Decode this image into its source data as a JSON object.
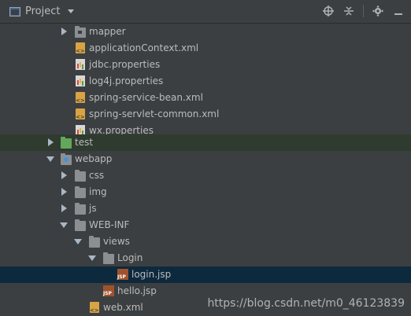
{
  "toolbar": {
    "title": "Project",
    "icons": [
      "locate-icon",
      "collapse-icon",
      "gear-icon",
      "hide-icon"
    ]
  },
  "tree": {
    "items": [
      {
        "label": "mapper",
        "icon": "folder-icon",
        "expanded": false
      },
      {
        "label": "applicationContext.xml",
        "icon": "xml-file-icon"
      },
      {
        "label": "jdbc.properties",
        "icon": "properties-file-icon"
      },
      {
        "label": "log4j.properties",
        "icon": "properties-file-icon"
      },
      {
        "label": "spring-service-bean.xml",
        "icon": "xml-file-icon"
      },
      {
        "label": "spring-servlet-common.xml",
        "icon": "xml-file-icon"
      },
      {
        "label": "wx.properties",
        "icon": "properties-file-icon"
      },
      {
        "label": "test",
        "icon": "folder-green-icon",
        "expanded": false
      },
      {
        "label": "webapp",
        "icon": "web-folder-icon",
        "expanded": true
      },
      {
        "label": "css",
        "icon": "folder-icon",
        "expanded": false
      },
      {
        "label": "img",
        "icon": "folder-icon",
        "expanded": false
      },
      {
        "label": "js",
        "icon": "folder-icon",
        "expanded": false
      },
      {
        "label": "WEB-INF",
        "icon": "folder-icon",
        "expanded": true
      },
      {
        "label": "views",
        "icon": "folder-icon",
        "expanded": true
      },
      {
        "label": "Login",
        "icon": "folder-icon",
        "expanded": true
      },
      {
        "label": "login.jsp",
        "icon": "jsp-file-icon",
        "selected": true
      },
      {
        "label": "hello.jsp",
        "icon": "jsp-file-icon"
      },
      {
        "label": "web.xml",
        "icon": "xml-file-icon"
      }
    ]
  },
  "watermark": "https://blog.csdn.net/m0_46123839",
  "colors": {
    "background": "#3c3f41",
    "selected": "#0d293e",
    "highlight": "#2f3b2f",
    "text": "#bbbbbb"
  }
}
